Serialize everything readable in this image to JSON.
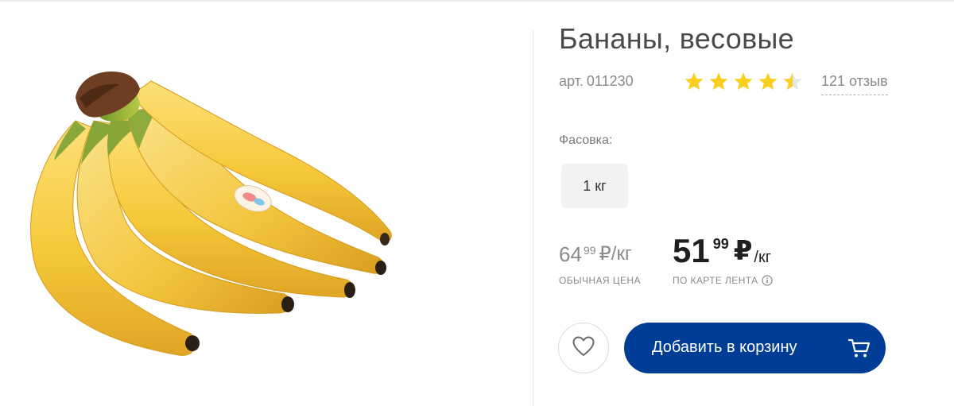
{
  "product": {
    "title": "Бананы, весовые",
    "sku_prefix": "арт.",
    "sku": "011230",
    "rating": 4.5,
    "rating_max": 5,
    "reviews_label": "121 отзыв"
  },
  "packaging": {
    "label": "Фасовка:",
    "options": [
      "1 кг"
    ],
    "selected": "1 кг"
  },
  "price": {
    "regular": {
      "integer": "64",
      "fraction": "99",
      "unit": "₽/кг",
      "label": "ОБЫЧНАЯ ЦЕНА"
    },
    "card": {
      "integer": "51",
      "fraction": "99",
      "currency": "₽",
      "unit": "/кг",
      "label": "ПО КАРТЕ ЛЕНТА"
    }
  },
  "actions": {
    "favorite_icon": "heart-icon",
    "add_to_cart_label": "Добавить в корзину",
    "cart_icon": "cart-icon"
  },
  "colors": {
    "accent": "#003d96",
    "star": "#f8cf1f",
    "star_empty": "#e6e6e6"
  }
}
